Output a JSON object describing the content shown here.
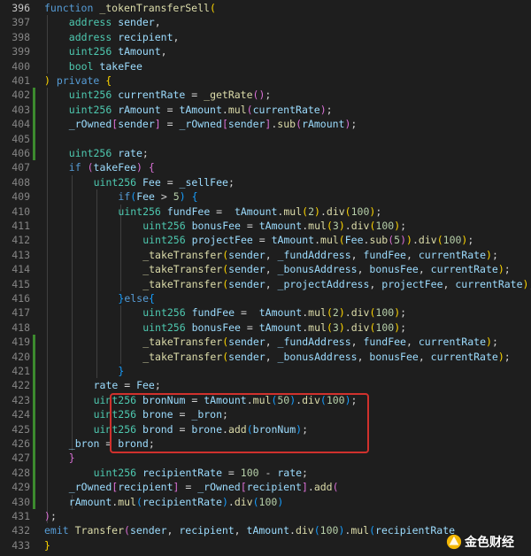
{
  "watermark": {
    "text": "金色财经",
    "icon": "golden-logo-icon"
  },
  "highlight_color": "#d0312d",
  "lines": [
    {
      "n": "396",
      "t": [
        [
          "kw",
          "function "
        ],
        [
          "fn",
          "_tokenTransferSell"
        ],
        [
          "p1",
          "("
        ]
      ]
    },
    {
      "n": "397",
      "t": [
        [
          "ty",
          "address "
        ],
        [
          "var",
          "sender"
        ],
        [
          "op",
          ","
        ]
      ]
    },
    {
      "n": "398",
      "t": [
        [
          "ty",
          "address "
        ],
        [
          "var",
          "recipient"
        ],
        [
          "op",
          ","
        ]
      ]
    },
    {
      "n": "399",
      "t": [
        [
          "ty",
          "uint256 "
        ],
        [
          "var",
          "tAmount"
        ],
        [
          "op",
          ","
        ]
      ]
    },
    {
      "n": "400",
      "t": [
        [
          "ty",
          "bool "
        ],
        [
          "var",
          "takeFee"
        ]
      ]
    },
    {
      "n": "401",
      "t": [
        [
          "p1",
          ")"
        ],
        [
          "op",
          " "
        ],
        [
          "kw",
          "private"
        ],
        [
          "op",
          " "
        ],
        [
          "p1",
          "{"
        ]
      ]
    },
    {
      "n": "402",
      "t": [
        [
          "ty",
          "uint256 "
        ],
        [
          "var",
          "currentRate"
        ],
        [
          "op",
          " = "
        ],
        [
          "fn",
          "_getRate"
        ],
        [
          "p2",
          "()"
        ],
        [
          "op",
          ";"
        ]
      ]
    },
    {
      "n": "403",
      "t": [
        [
          "ty",
          "uint256 "
        ],
        [
          "var",
          "rAmount"
        ],
        [
          "op",
          " = "
        ],
        [
          "var",
          "tAmount"
        ],
        [
          "op",
          "."
        ],
        [
          "fn",
          "mul"
        ],
        [
          "p2",
          "("
        ],
        [
          "var",
          "currentRate"
        ],
        [
          "p2",
          ")"
        ],
        [
          "op",
          ";"
        ]
      ]
    },
    {
      "n": "404",
      "t": [
        [
          "var",
          "_rOwned"
        ],
        [
          "p2",
          "["
        ],
        [
          "var",
          "sender"
        ],
        [
          "p2",
          "]"
        ],
        [
          "op",
          " = "
        ],
        [
          "var",
          "_rOwned"
        ],
        [
          "p2",
          "["
        ],
        [
          "var",
          "sender"
        ],
        [
          "p2",
          "]"
        ],
        [
          "op",
          "."
        ],
        [
          "fn",
          "sub"
        ],
        [
          "p2",
          "("
        ],
        [
          "var",
          "rAmount"
        ],
        [
          "p2",
          ")"
        ],
        [
          "op",
          ";"
        ]
      ]
    },
    {
      "n": "405",
      "t": []
    },
    {
      "n": "406",
      "t": [
        [
          "ty",
          "uint256 "
        ],
        [
          "var",
          "rate"
        ],
        [
          "op",
          ";"
        ]
      ]
    },
    {
      "n": "407",
      "t": [
        [
          "kw",
          "if"
        ],
        [
          "op",
          " "
        ],
        [
          "p2",
          "("
        ],
        [
          "var",
          "takeFee"
        ],
        [
          "p2",
          ")"
        ],
        [
          "op",
          " "
        ],
        [
          "p2",
          "{"
        ]
      ]
    },
    {
      "n": "408",
      "t": [
        [
          "ty",
          "uint256 "
        ],
        [
          "var",
          "Fee"
        ],
        [
          "op",
          " = "
        ],
        [
          "var",
          "_sellFee"
        ],
        [
          "op",
          ";"
        ]
      ]
    },
    {
      "n": "409",
      "t": [
        [
          "kw",
          "if"
        ],
        [
          "p3",
          "("
        ],
        [
          "var",
          "Fee"
        ],
        [
          "op",
          " > "
        ],
        [
          "num",
          "5"
        ],
        [
          "p3",
          ")"
        ],
        [
          "op",
          " "
        ],
        [
          "p3",
          "{"
        ]
      ]
    },
    {
      "n": "410",
      "t": [
        [
          "ty",
          "uint256 "
        ],
        [
          "var",
          "fundFee"
        ],
        [
          "op",
          " =  "
        ],
        [
          "var",
          "tAmount"
        ],
        [
          "op",
          "."
        ],
        [
          "fn",
          "mul"
        ],
        [
          "p1",
          "("
        ],
        [
          "num",
          "2"
        ],
        [
          "p1",
          ")"
        ],
        [
          "op",
          "."
        ],
        [
          "fn",
          "div"
        ],
        [
          "p1",
          "("
        ],
        [
          "num",
          "100"
        ],
        [
          "p1",
          ")"
        ],
        [
          "op",
          ";"
        ]
      ]
    },
    {
      "n": "411",
      "t": [
        [
          "ty",
          "uint256 "
        ],
        [
          "var",
          "bonusFee"
        ],
        [
          "op",
          " = "
        ],
        [
          "var",
          "tAmount"
        ],
        [
          "op",
          "."
        ],
        [
          "fn",
          "mul"
        ],
        [
          "p1",
          "("
        ],
        [
          "num",
          "3"
        ],
        [
          "p1",
          ")"
        ],
        [
          "op",
          "."
        ],
        [
          "fn",
          "div"
        ],
        [
          "p1",
          "("
        ],
        [
          "num",
          "100"
        ],
        [
          "p1",
          ")"
        ],
        [
          "op",
          ";"
        ]
      ]
    },
    {
      "n": "412",
      "t": [
        [
          "ty",
          "uint256 "
        ],
        [
          "var",
          "projectFee"
        ],
        [
          "op",
          " = "
        ],
        [
          "var",
          "tAmount"
        ],
        [
          "op",
          "."
        ],
        [
          "fn",
          "mul"
        ],
        [
          "p1",
          "("
        ],
        [
          "var",
          "Fee"
        ],
        [
          "op",
          "."
        ],
        [
          "fn",
          "sub"
        ],
        [
          "p2",
          "("
        ],
        [
          "num",
          "5"
        ],
        [
          "p2",
          ")"
        ],
        [
          "p1",
          ")"
        ],
        [
          "op",
          "."
        ],
        [
          "fn",
          "div"
        ],
        [
          "p1",
          "("
        ],
        [
          "num",
          "100"
        ],
        [
          "p1",
          ")"
        ],
        [
          "op",
          ";"
        ]
      ]
    },
    {
      "n": "413",
      "t": [
        [
          "fn",
          "_takeTransfer"
        ],
        [
          "p1",
          "("
        ],
        [
          "var",
          "sender"
        ],
        [
          "op",
          ", "
        ],
        [
          "var",
          "_fundAddress"
        ],
        [
          "op",
          ", "
        ],
        [
          "var",
          "fundFee"
        ],
        [
          "op",
          ", "
        ],
        [
          "var",
          "currentRate"
        ],
        [
          "p1",
          ")"
        ],
        [
          "op",
          ";"
        ]
      ]
    },
    {
      "n": "414",
      "t": [
        [
          "fn",
          "_takeTransfer"
        ],
        [
          "p1",
          "("
        ],
        [
          "var",
          "sender"
        ],
        [
          "op",
          ", "
        ],
        [
          "var",
          "_bonusAddress"
        ],
        [
          "op",
          ", "
        ],
        [
          "var",
          "bonusFee"
        ],
        [
          "op",
          ", "
        ],
        [
          "var",
          "currentRate"
        ],
        [
          "p1",
          ")"
        ],
        [
          "op",
          ";"
        ]
      ]
    },
    {
      "n": "415",
      "t": [
        [
          "fn",
          "_takeTransfer"
        ],
        [
          "p1",
          "("
        ],
        [
          "var",
          "sender"
        ],
        [
          "op",
          ", "
        ],
        [
          "var",
          "_projectAddress"
        ],
        [
          "op",
          ", "
        ],
        [
          "var",
          "projectFee"
        ],
        [
          "op",
          ", "
        ],
        [
          "var",
          "currentRate"
        ],
        [
          "p1",
          ")"
        ],
        [
          "op",
          ";"
        ]
      ]
    },
    {
      "n": "416",
      "t": [
        [
          "p3",
          "}"
        ],
        [
          "kw",
          "else"
        ],
        [
          "p3",
          "{"
        ]
      ]
    },
    {
      "n": "417",
      "t": [
        [
          "ty",
          "uint256 "
        ],
        [
          "var",
          "fundFee"
        ],
        [
          "op",
          " =  "
        ],
        [
          "var",
          "tAmount"
        ],
        [
          "op",
          "."
        ],
        [
          "fn",
          "mul"
        ],
        [
          "p1",
          "("
        ],
        [
          "num",
          "2"
        ],
        [
          "p1",
          ")"
        ],
        [
          "op",
          "."
        ],
        [
          "fn",
          "div"
        ],
        [
          "p1",
          "("
        ],
        [
          "num",
          "100"
        ],
        [
          "p1",
          ")"
        ],
        [
          "op",
          ";"
        ]
      ]
    },
    {
      "n": "418",
      "t": [
        [
          "ty",
          "uint256 "
        ],
        [
          "var",
          "bonusFee"
        ],
        [
          "op",
          " = "
        ],
        [
          "var",
          "tAmount"
        ],
        [
          "op",
          "."
        ],
        [
          "fn",
          "mul"
        ],
        [
          "p1",
          "("
        ],
        [
          "num",
          "3"
        ],
        [
          "p1",
          ")"
        ],
        [
          "op",
          "."
        ],
        [
          "fn",
          "div"
        ],
        [
          "p1",
          "("
        ],
        [
          "num",
          "100"
        ],
        [
          "p1",
          ")"
        ],
        [
          "op",
          ";"
        ]
      ]
    },
    {
      "n": "419",
      "t": [
        [
          "fn",
          "_takeTransfer"
        ],
        [
          "p1",
          "("
        ],
        [
          "var",
          "sender"
        ],
        [
          "op",
          ", "
        ],
        [
          "var",
          "_fundAddress"
        ],
        [
          "op",
          ", "
        ],
        [
          "var",
          "fundFee"
        ],
        [
          "op",
          ", "
        ],
        [
          "var",
          "currentRate"
        ],
        [
          "p1",
          ")"
        ],
        [
          "op",
          ";"
        ]
      ]
    },
    {
      "n": "420",
      "t": [
        [
          "fn",
          "_takeTransfer"
        ],
        [
          "p1",
          "("
        ],
        [
          "var",
          "sender"
        ],
        [
          "op",
          ", "
        ],
        [
          "var",
          "_bonusAddress"
        ],
        [
          "op",
          ", "
        ],
        [
          "var",
          "bonusFee"
        ],
        [
          "op",
          ", "
        ],
        [
          "var",
          "currentRate"
        ],
        [
          "p1",
          ")"
        ],
        [
          "op",
          ";"
        ]
      ]
    },
    {
      "n": "421",
      "t": [
        [
          "p3",
          "}"
        ]
      ]
    },
    {
      "n": "422",
      "t": [
        [
          "var",
          "rate"
        ],
        [
          "op",
          " = "
        ],
        [
          "var",
          "Fee"
        ],
        [
          "op",
          ";"
        ]
      ]
    },
    {
      "n": "423",
      "t": [
        [
          "ty",
          "uint256 "
        ],
        [
          "var",
          "bronNum"
        ],
        [
          "op",
          " = "
        ],
        [
          "var",
          "tAmount"
        ],
        [
          "op",
          "."
        ],
        [
          "fn",
          "mul"
        ],
        [
          "p3",
          "("
        ],
        [
          "num",
          "50"
        ],
        [
          "p3",
          ")"
        ],
        [
          "op",
          "."
        ],
        [
          "fn",
          "div"
        ],
        [
          "p3",
          "("
        ],
        [
          "num",
          "100"
        ],
        [
          "p3",
          ")"
        ],
        [
          "op",
          ";"
        ]
      ]
    },
    {
      "n": "424",
      "t": [
        [
          "ty",
          "uint256 "
        ],
        [
          "var",
          "brone"
        ],
        [
          "op",
          " = "
        ],
        [
          "var",
          "_bron"
        ],
        [
          "op",
          ";"
        ]
      ]
    },
    {
      "n": "425",
      "t": [
        [
          "ty",
          "uint256 "
        ],
        [
          "var",
          "brond"
        ],
        [
          "op",
          " = "
        ],
        [
          "var",
          "brone"
        ],
        [
          "op",
          "."
        ],
        [
          "fn",
          "add"
        ],
        [
          "p3",
          "("
        ],
        [
          "var",
          "bronNum"
        ],
        [
          "p3",
          ")"
        ],
        [
          "op",
          ";"
        ]
      ]
    },
    {
      "n": "426",
      "t": [
        [
          "var",
          "_bron"
        ],
        [
          "op",
          " = "
        ],
        [
          "var",
          "brond"
        ],
        [
          "op",
          ";"
        ]
      ]
    },
    {
      "n": "427",
      "t": [
        [
          "p2",
          "}"
        ]
      ]
    },
    {
      "n": "428",
      "t": [
        [
          "ty",
          "uint256 "
        ],
        [
          "var",
          "recipientRate"
        ],
        [
          "op",
          " = "
        ],
        [
          "num",
          "100"
        ],
        [
          "op",
          " - "
        ],
        [
          "var",
          "rate"
        ],
        [
          "op",
          ";"
        ]
      ]
    },
    {
      "n": "429",
      "t": [
        [
          "var",
          "_rOwned"
        ],
        [
          "p2",
          "["
        ],
        [
          "var",
          "recipient"
        ],
        [
          "p2",
          "]"
        ],
        [
          "op",
          " = "
        ],
        [
          "var",
          "_rOwned"
        ],
        [
          "p2",
          "["
        ],
        [
          "var",
          "recipient"
        ],
        [
          "p2",
          "]"
        ],
        [
          "op",
          "."
        ],
        [
          "fn",
          "add"
        ],
        [
          "p2",
          "("
        ]
      ]
    },
    {
      "n": "430",
      "t": [
        [
          "var",
          "rAmount"
        ],
        [
          "op",
          "."
        ],
        [
          "fn",
          "mul"
        ],
        [
          "p3",
          "("
        ],
        [
          "var",
          "recipientRate"
        ],
        [
          "p3",
          ")"
        ],
        [
          "op",
          "."
        ],
        [
          "fn",
          "div"
        ],
        [
          "p3",
          "("
        ],
        [
          "num",
          "100"
        ],
        [
          "p3",
          ")"
        ]
      ]
    },
    {
      "n": "431",
      "t": [
        [
          "p2",
          ")"
        ],
        [
          "op",
          ";"
        ]
      ]
    },
    {
      "n": "432",
      "t": [
        [
          "kw",
          "emit "
        ],
        [
          "fn",
          "Transfer"
        ],
        [
          "p2",
          "("
        ],
        [
          "var",
          "sender"
        ],
        [
          "op",
          ", "
        ],
        [
          "var",
          "recipient"
        ],
        [
          "op",
          ", "
        ],
        [
          "var",
          "tAmount"
        ],
        [
          "op",
          "."
        ],
        [
          "fn",
          "div"
        ],
        [
          "p3",
          "("
        ],
        [
          "num",
          "100"
        ],
        [
          "p3",
          ")"
        ],
        [
          "op",
          "."
        ],
        [
          "fn",
          "mul"
        ],
        [
          "p3",
          "("
        ],
        [
          "var",
          "recipientRate"
        ]
      ]
    },
    {
      "n": "433",
      "t": [
        [
          "p1",
          "}"
        ]
      ]
    }
  ]
}
